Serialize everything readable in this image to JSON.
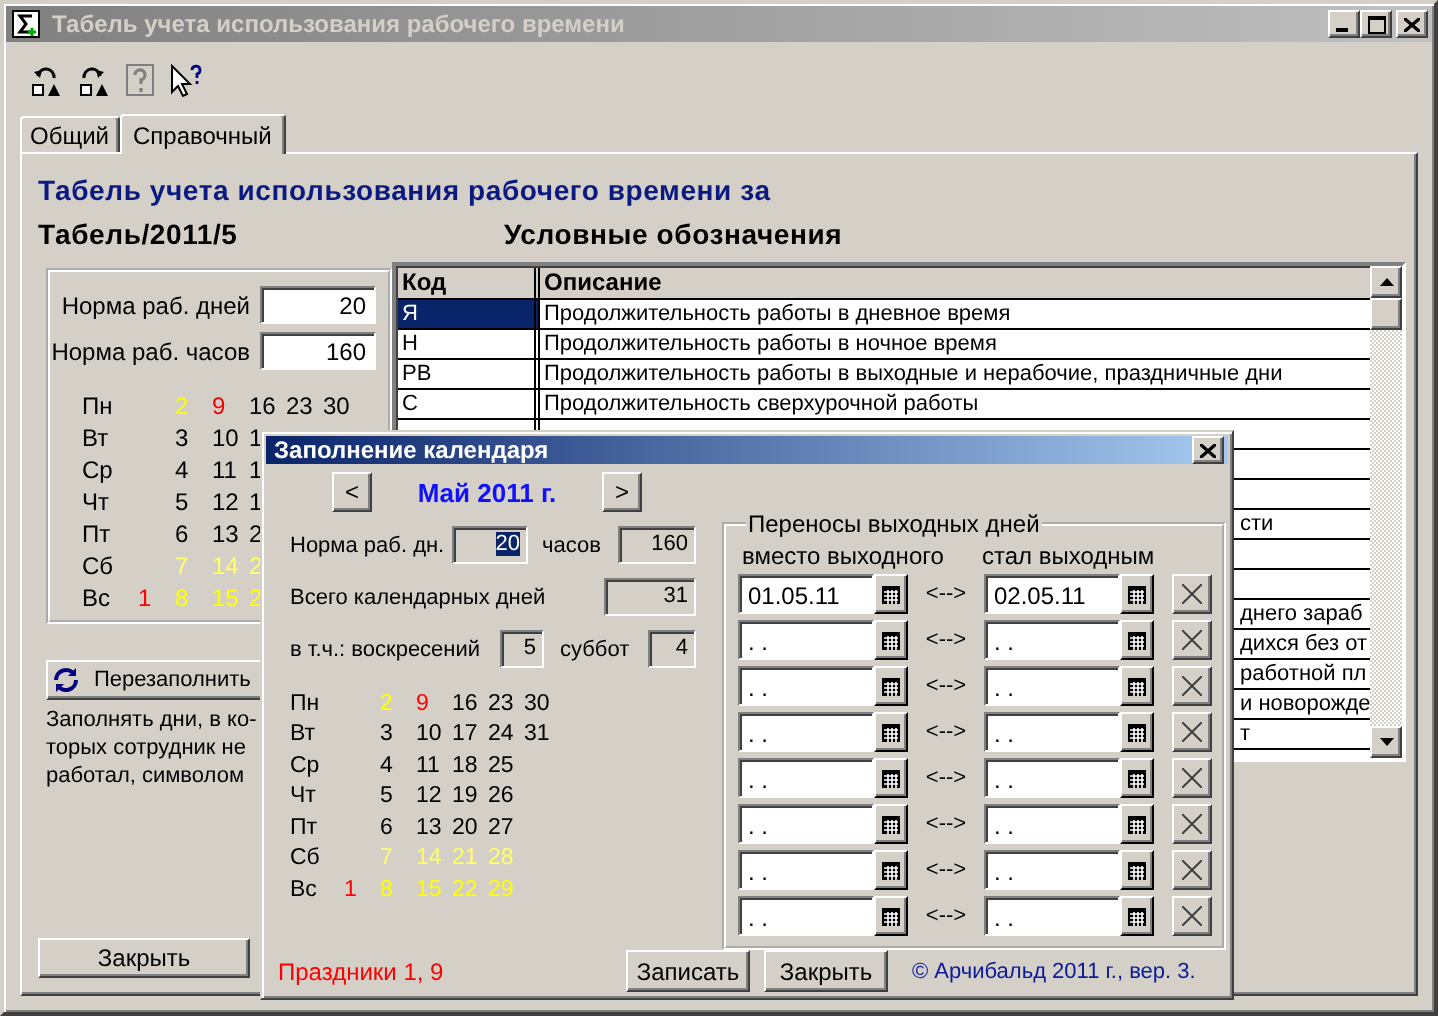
{
  "window": {
    "title": "Табель учета использования рабочего времени"
  },
  "tabs": [
    {
      "label": "Общий",
      "selected": false
    },
    {
      "label": "Справочный",
      "selected": true
    }
  ],
  "heading": "Табель учета использования рабочего времени за",
  "document": "Табель/2011/5",
  "norms": [
    {
      "label": "Норма раб. дней",
      "value": "20"
    },
    {
      "label": "Норма раб. часов",
      "value": "160"
    }
  ],
  "calendar": [
    {
      "day": "Пн",
      "dates": [
        {
          "text": "2",
          "color": "#ffff00"
        },
        {
          "text": "9",
          "color": "#ff0000"
        },
        {
          "text": "16",
          "color": "#000000"
        },
        {
          "text": "23",
          "color": "#000000"
        },
        {
          "text": "30",
          "color": "#000000"
        }
      ]
    },
    {
      "day": "Вт",
      "dates": [
        {
          "text": "3",
          "color": "#000000"
        },
        {
          "text": "10",
          "color": "#000000"
        },
        {
          "text": "1",
          "color": "#000000"
        }
      ]
    },
    {
      "day": "Ср",
      "dates": [
        {
          "text": "4",
          "color": "#000000"
        },
        {
          "text": "11",
          "color": "#000000"
        },
        {
          "text": "1",
          "color": "#000000"
        }
      ]
    },
    {
      "day": "Чт",
      "dates": [
        {
          "text": "5",
          "color": "#000000"
        },
        {
          "text": "12",
          "color": "#000000"
        },
        {
          "text": "1",
          "color": "#000000"
        }
      ]
    },
    {
      "day": "Пт",
      "dates": [
        {
          "text": "6",
          "color": "#000000"
        },
        {
          "text": "13",
          "color": "#000000"
        },
        {
          "text": "2",
          "color": "#000000"
        }
      ]
    },
    {
      "day": "Сб",
      "dates": [
        {
          "text": "7",
          "color": "#ffff66"
        },
        {
          "text": "14",
          "color": "#ffff66"
        },
        {
          "text": "2",
          "color": "#ffff66"
        }
      ]
    },
    {
      "day": "Вс",
      "first_week_date": {
        "text": "1",
        "color": "#ff0000"
      },
      "dates": [
        {
          "text": "8",
          "color": "#ffff00"
        },
        {
          "text": "15",
          "color": "#ffff00"
        },
        {
          "text": "2",
          "color": "#ffff00"
        }
      ]
    }
  ],
  "refill_button": "Перезаполнить",
  "note_lines": [
    "Заполнять дни, в ко-",
    "торых сотрудник не",
    "работал, символом"
  ],
  "close_button": "Закрыть",
  "legend": {
    "title": "Условные обозначения",
    "columns": [
      "Код",
      "Описание"
    ],
    "rows": [
      {
        "kind": "full",
        "code": "Я",
        "description": "Продолжительность работы в дневное время",
        "selected": true
      },
      {
        "kind": "full",
        "code": "Н",
        "description": "Продолжительность работы в ночное время",
        "selected": false
      },
      {
        "kind": "full",
        "code": "РВ",
        "description": "Продолжительность работы в выходные и нерабочие, праздничные дни",
        "selected": false
      },
      {
        "kind": "full",
        "code": "С",
        "description": "Продолжительность сверхурочной работы",
        "selected": false
      },
      {
        "kind": "partial"
      },
      {
        "kind": "partial"
      },
      {
        "kind": "partial"
      },
      {
        "kind": "partial",
        "description": "сти"
      },
      {
        "kind": "partial"
      },
      {
        "kind": "partial"
      },
      {
        "kind": "partial",
        "description": "днего зараб"
      },
      {
        "kind": "partial",
        "description": "дихся без от"
      },
      {
        "kind": "partial",
        "description": "работной пл"
      },
      {
        "kind": "partial",
        "description": "и новорожде"
      },
      {
        "kind": "partial",
        "description": "т"
      }
    ]
  },
  "dialog": {
    "title": "Заполнение календаря",
    "prev": "<",
    "month": "Май 2011 г.",
    "next": ">",
    "work_days": {
      "label": "Норма раб. дн.",
      "value": "20",
      "highlighted": true
    },
    "hours": {
      "label": "часов",
      "value": "160"
    },
    "total": {
      "label": "Всего календарных дней",
      "value": "31"
    },
    "sundays": {
      "label": "в т.ч.: воскресений",
      "value": "5"
    },
    "saturdays": {
      "label": "суббот",
      "value": "4"
    },
    "calendar": [
      {
        "day": "Пн",
        "dates": [
          {
            "text": "2",
            "color": "#ffff00"
          },
          {
            "text": "9",
            "color": "#ff0000"
          },
          {
            "text": "16",
            "color": "#000000"
          },
          {
            "text": "23",
            "color": "#000000"
          },
          {
            "text": "30",
            "color": "#000000"
          }
        ]
      },
      {
        "day": "Вт",
        "dates": [
          {
            "text": "3",
            "color": "#000000"
          },
          {
            "text": "10",
            "color": "#000000"
          },
          {
            "text": "17",
            "color": "#000000"
          },
          {
            "text": "24",
            "color": "#000000"
          },
          {
            "text": "31",
            "color": "#000000"
          }
        ]
      },
      {
        "day": "Ср",
        "dates": [
          {
            "text": "4",
            "color": "#000000"
          },
          {
            "text": "11",
            "color": "#000000"
          },
          {
            "text": "18",
            "color": "#000000"
          },
          {
            "text": "25",
            "color": "#000000"
          }
        ]
      },
      {
        "day": "Чт",
        "dates": [
          {
            "text": "5",
            "color": "#000000"
          },
          {
            "text": "12",
            "color": "#000000"
          },
          {
            "text": "19",
            "color": "#000000"
          },
          {
            "text": "26",
            "color": "#000000"
          }
        ]
      },
      {
        "day": "Пт",
        "dates": [
          {
            "text": "6",
            "color": "#000000"
          },
          {
            "text": "13",
            "color": "#000000"
          },
          {
            "text": "20",
            "color": "#000000"
          },
          {
            "text": "27",
            "color": "#000000"
          }
        ]
      },
      {
        "day": "Сб",
        "dates": [
          {
            "text": "7",
            "color": "#ffff66"
          },
          {
            "text": "14",
            "color": "#ffff66"
          },
          {
            "text": "21",
            "color": "#ffff66"
          },
          {
            "text": "28",
            "color": "#ffff66"
          }
        ]
      },
      {
        "day": "Вс",
        "first_week_date": {
          "text": "1",
          "color": "#ff0000"
        },
        "dates": [
          {
            "text": "8",
            "color": "#ffff00"
          },
          {
            "text": "15",
            "color": "#ffff00"
          },
          {
            "text": "22",
            "color": "#ffff00"
          },
          {
            "text": "29",
            "color": "#ffff00"
          }
        ]
      }
    ],
    "holidays": "Праздники 1, 9",
    "transfers": {
      "title": "Переносы выходных дней",
      "columns": [
        "вместо выходного",
        "стал выходным"
      ],
      "rows": [
        {
          "from": "01.05.11",
          "arrow": "<-->",
          "to": "02.05.11"
        },
        {
          "from": ". .",
          "arrow": "<-->",
          "to": ". ."
        },
        {
          "from": ". .",
          "arrow": "<-->",
          "to": ". ."
        },
        {
          "from": ". .",
          "arrow": "<-->",
          "to": ". ."
        },
        {
          "from": ". .",
          "arrow": "<-->",
          "to": ". ."
        },
        {
          "from": ". .",
          "arrow": "<-->",
          "to": ". ."
        },
        {
          "from": ". .",
          "arrow": "<-->",
          "to": ". ."
        },
        {
          "from": ". .",
          "arrow": "<-->",
          "to": ". ."
        }
      ]
    },
    "buttons": [
      "Записать",
      "Закрыть"
    ],
    "copyright": "© Арчибальд 2011 г., вер. 3."
  }
}
